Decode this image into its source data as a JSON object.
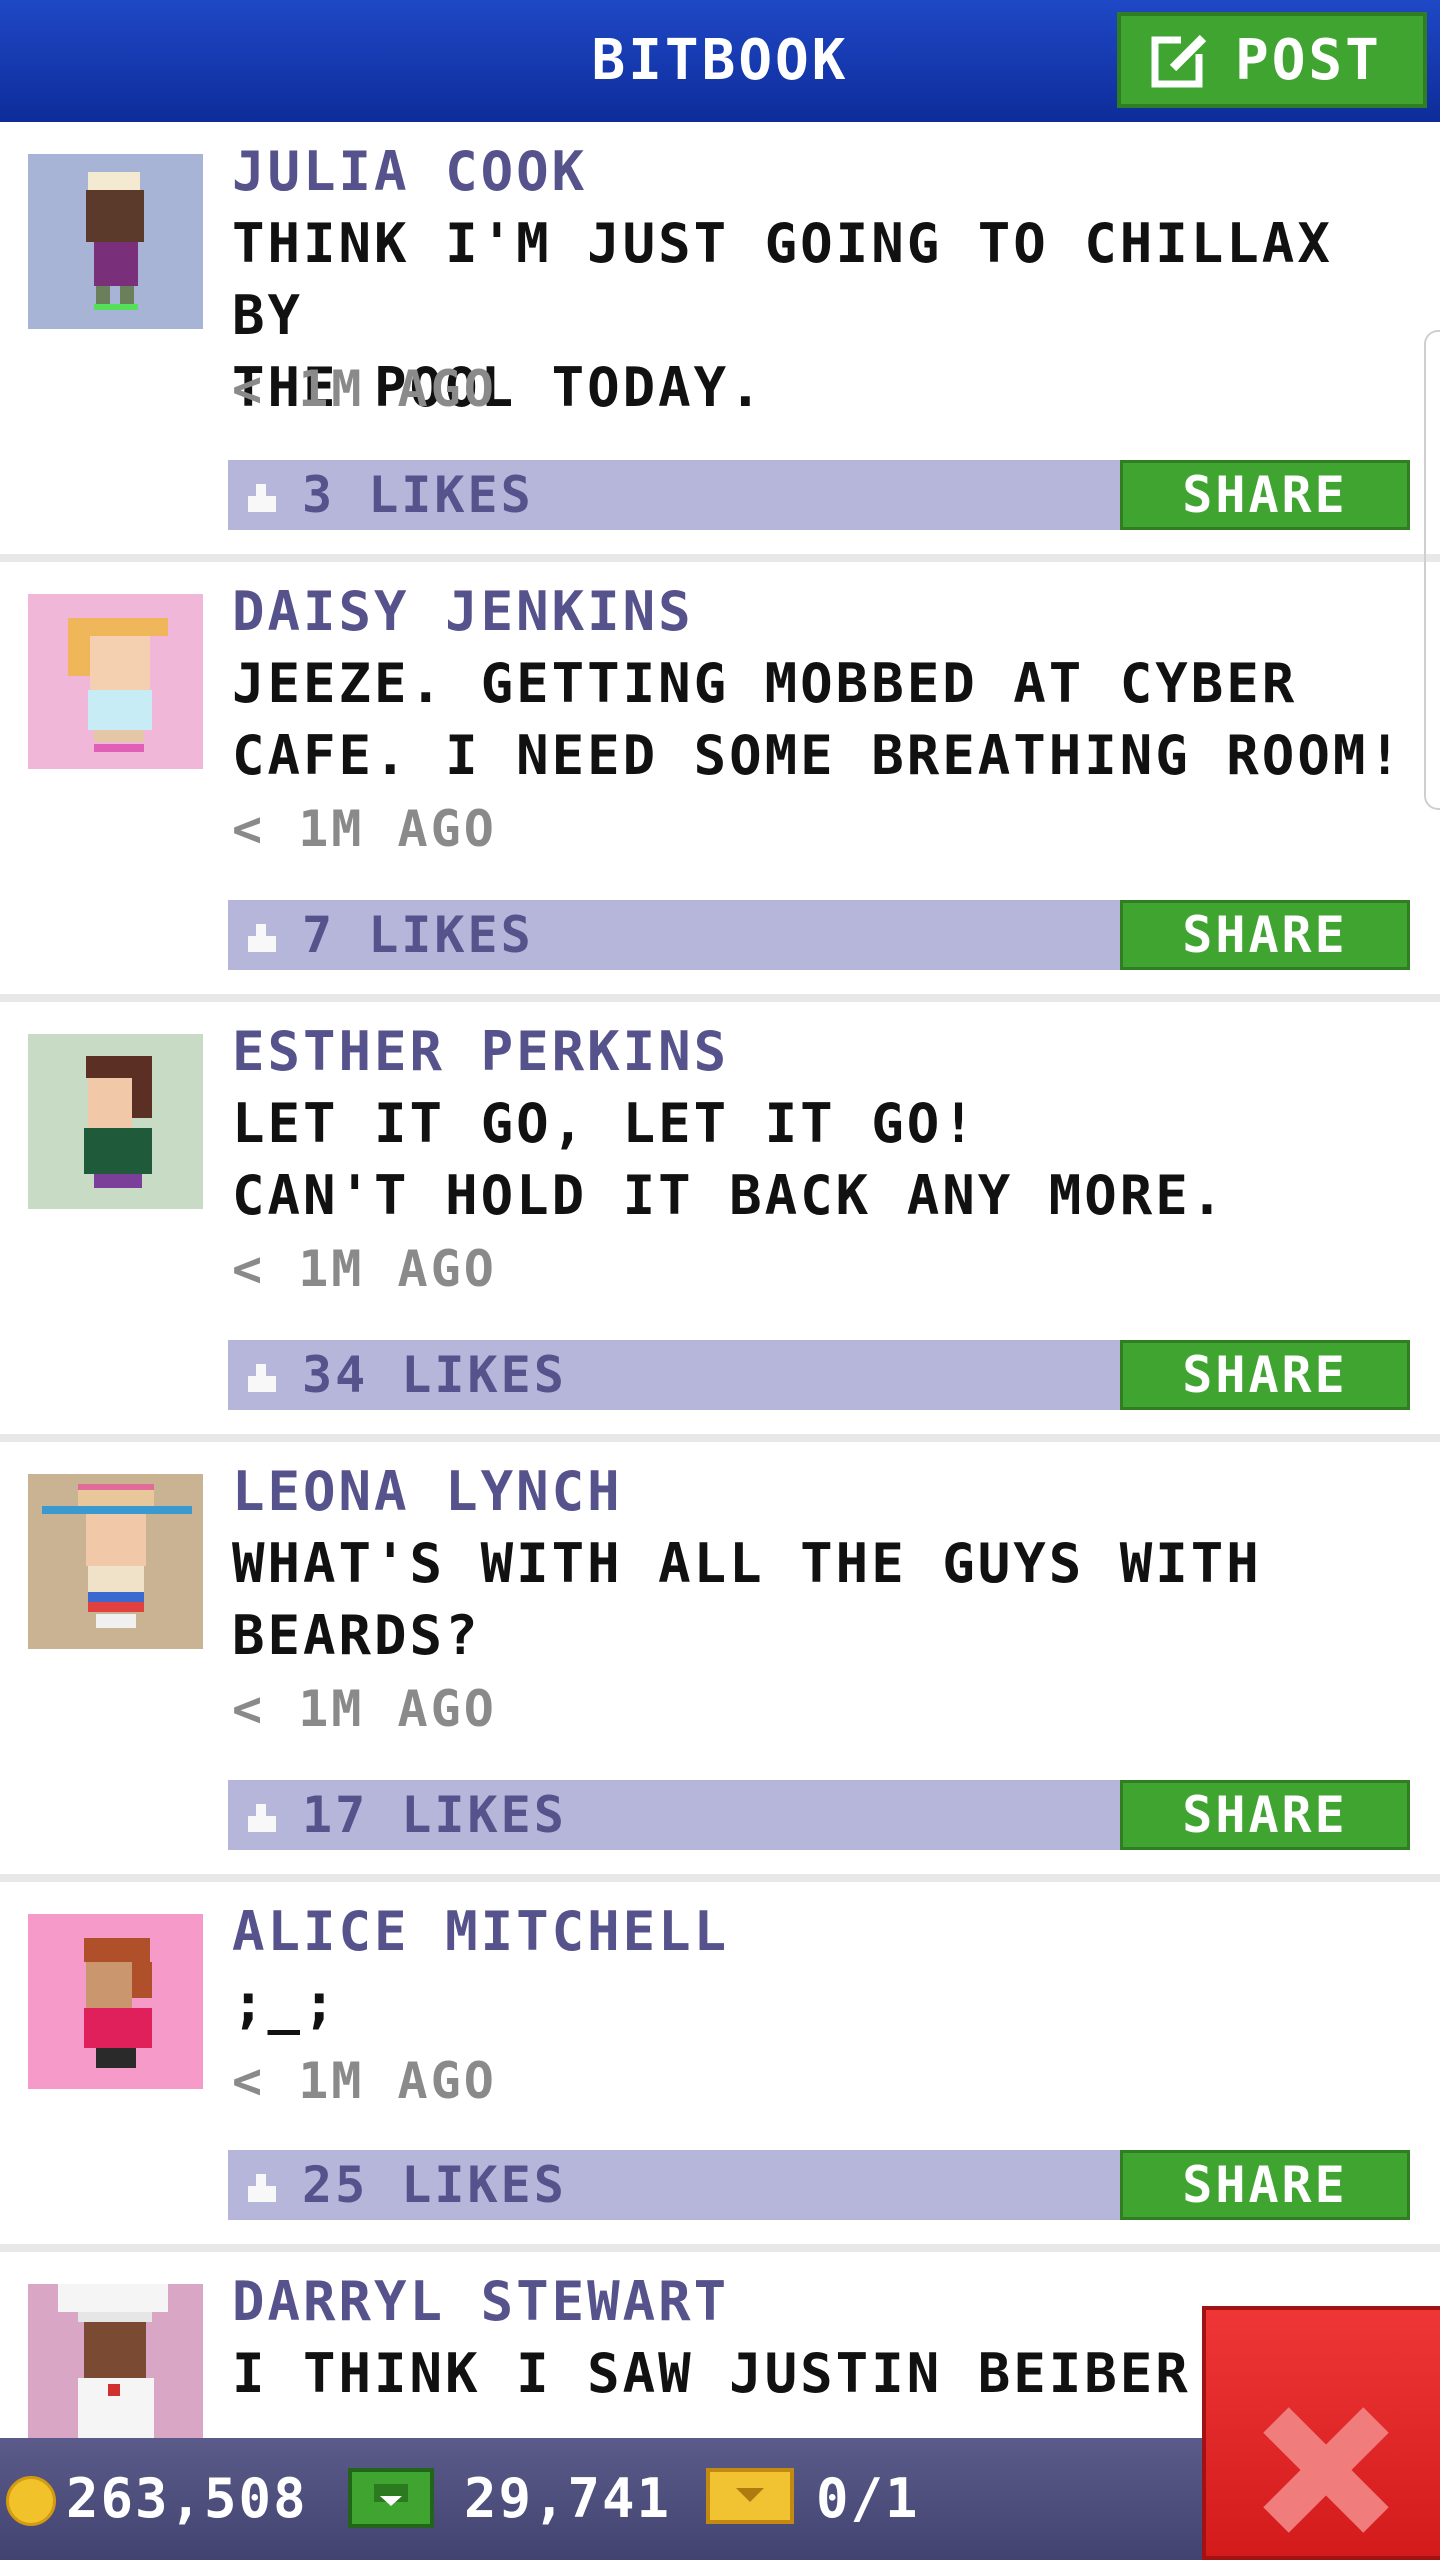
{
  "header": {
    "title": "BITBOOK",
    "post_label": "POST"
  },
  "posts": [
    {
      "author": "JULIA COOK",
      "message": "THINK I'M JUST GOING TO CHILLAX BY\nTHE POOL TODAY.",
      "time": "< 1M AGO",
      "likes": "3 LIKES",
      "share": "SHARE",
      "avatar_bg": "#a7b4d6"
    },
    {
      "author": "DAISY JENKINS",
      "message": "JEEZE. GETTING MOBBED AT CYBER\nCAFE. I NEED SOME BREATHING ROOM!",
      "time": "< 1M AGO",
      "likes": "7 LIKES",
      "share": "SHARE",
      "avatar_bg": "#f0b7d8"
    },
    {
      "author": "ESTHER PERKINS",
      "message": "LET IT GO, LET IT GO!\nCAN'T HOLD IT BACK ANY MORE.",
      "time": "< 1M AGO",
      "likes": "34 LIKES",
      "share": "SHARE",
      "avatar_bg": "#c8dcc5"
    },
    {
      "author": "LEONA LYNCH",
      "message": "WHAT'S WITH ALL THE GUYS WITH\nBEARDS?",
      "time": "< 1M AGO",
      "likes": "17 LIKES",
      "share": "SHARE",
      "avatar_bg": "#c9b393"
    },
    {
      "author": "ALICE MITCHELL",
      "message": ";_;",
      "time": "< 1M AGO",
      "likes": "25 LIKES",
      "share": "SHARE",
      "avatar_bg": "#f59ac9"
    },
    {
      "author": "DARRYL STEWART",
      "message": "I THINK I SAW JUSTIN BEIBER! DO",
      "avatar_bg": "#d9a6c6"
    }
  ],
  "footer": {
    "coins": "263,508",
    "cash": "29,741",
    "tickets": "0/1"
  },
  "colors": {
    "header": "#1f48c6",
    "accent_green": "#3fa530",
    "likes_bar": "#b6b6da",
    "author": "#56528c",
    "close": "#e02626"
  },
  "icons": {
    "post": "edit-icon",
    "like": "thumbs-up-icon",
    "coin": "coin-icon",
    "cash": "cash-icon",
    "ticket": "ticket-icon",
    "close": "close-icon"
  }
}
